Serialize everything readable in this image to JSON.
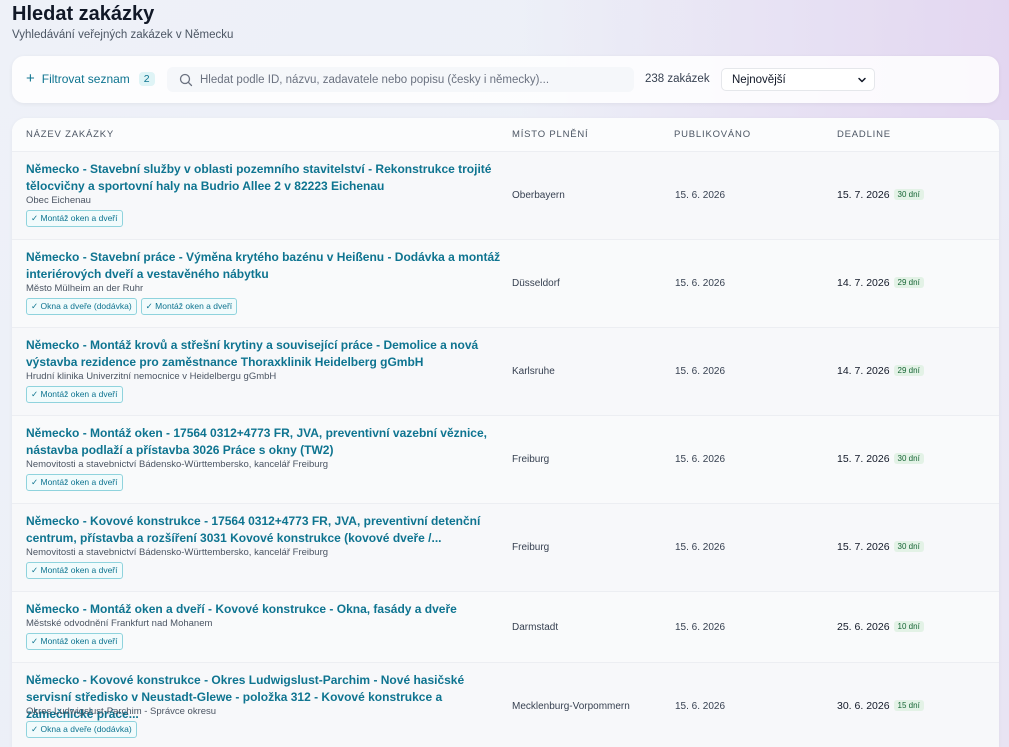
{
  "header": {
    "title": "Hledat zakázky",
    "subtitle": "Vyhledávání veřejných zakázek v Německu"
  },
  "toolbar": {
    "filter_label": "Filtrovat seznam",
    "filter_count": "2",
    "search_placeholder": "Hledat podle ID, názvu, zadavatele nebo popisu (česky i německy)...",
    "result_count": "238 zakázek",
    "sort_value": "Nejnovější",
    "icons": {
      "filter": "plus-icon",
      "search": "search-icon",
      "sort": "chevron-down-icon"
    }
  },
  "table": {
    "columns": [
      "Název zakázky",
      "Místo plnění",
      "Publikováno",
      "Deadline"
    ],
    "rows": [
      {
        "title": "Německo - Stavební služby v oblasti pozemního stavitelství - Rekonstrukce trojité tělocvičny a sportovní haly na Budrio Allee 2 v 82223 Eichenau",
        "org": "Obec Eichenau",
        "tags": [
          "✓ Montáž oken a dveří"
        ],
        "place": "Oberbayern",
        "published": "15. 6. 2026",
        "deadline": "15. 7. 2026",
        "days": "30 dní"
      },
      {
        "title": "Německo - Stavební práce - Výměna krytého bazénu v Heißenu - Dodávka a montáž interiérových dveří a vestavěného nábytku",
        "org": "Město Mülheim an der Ruhr",
        "tags": [
          "✓ Okna a dveře (dodávka)",
          "✓ Montáž oken a dveří"
        ],
        "place": "Düsseldorf",
        "published": "15. 6. 2026",
        "deadline": "14. 7. 2026",
        "days": "29 dní"
      },
      {
        "title": "Německo - Montáž krovů a střešní krytiny a související práce - Demolice a nová výstavba rezidence pro zaměstnance Thoraxklinik Heidelberg gGmbH",
        "org": "Hrudní klinika Univerzitní nemocnice v Heidelbergu gGmbH",
        "tags": [
          "✓ Montáž oken a dveří"
        ],
        "place": "Karlsruhe",
        "published": "15. 6. 2026",
        "deadline": "14. 7. 2026",
        "days": "29 dní"
      },
      {
        "title": "Německo - Montáž oken - 17564 0312+4773 FR, JVA, preventivní vazební věznice, nástavba podlaží a přístavba 3026 Práce s okny (TW2)",
        "org": "Nemovitosti a stavebnictví Bádensko-Württembersko, kancelář Freiburg",
        "tags": [
          "✓ Montáž oken a dveří"
        ],
        "place": "Freiburg",
        "published": "15. 6. 2026",
        "deadline": "15. 7. 2026",
        "days": "30 dní"
      },
      {
        "title": "Německo - Kovové konstrukce - 17564 0312+4773 FR, JVA, preventivní detenční centrum, přístavba a rozšíření 3031 Kovové konstrukce (kovové dveře /...",
        "org": "Nemovitosti a stavebnictví Bádensko-Württembersko, kancelář Freiburg",
        "tags": [
          "✓ Montáž oken a dveří"
        ],
        "place": "Freiburg",
        "published": "15. 6. 2026",
        "deadline": "15. 7. 2026",
        "days": "30 dní"
      },
      {
        "title": "Německo - Montáž oken a dveří - Kovové konstrukce - Okna, fasády a dveře",
        "org": "Městské odvodnění Frankfurt nad Mohanem",
        "tags": [
          "✓ Montáž oken a dveří"
        ],
        "place": "Darmstadt",
        "published": "15. 6. 2026",
        "deadline": "25. 6. 2026",
        "days": "10 dní"
      },
      {
        "title": "Německo - Kovové konstrukce - Okres Ludwigslust-Parchim - Nové hasičské servisní středisko v Neustadt-Glewe - položka 312 - Kovové konstrukce a zámečnické práce...",
        "org": "Okres Ludwigslust-Parchim - Správce okresu",
        "tags": [
          "✓ Okna a dveře (dodávka)"
        ],
        "place": "Mecklenburg-Vorpommern",
        "published": "15. 6. 2026",
        "deadline": "30. 6. 2026",
        "days": "15 dní"
      }
    ]
  }
}
